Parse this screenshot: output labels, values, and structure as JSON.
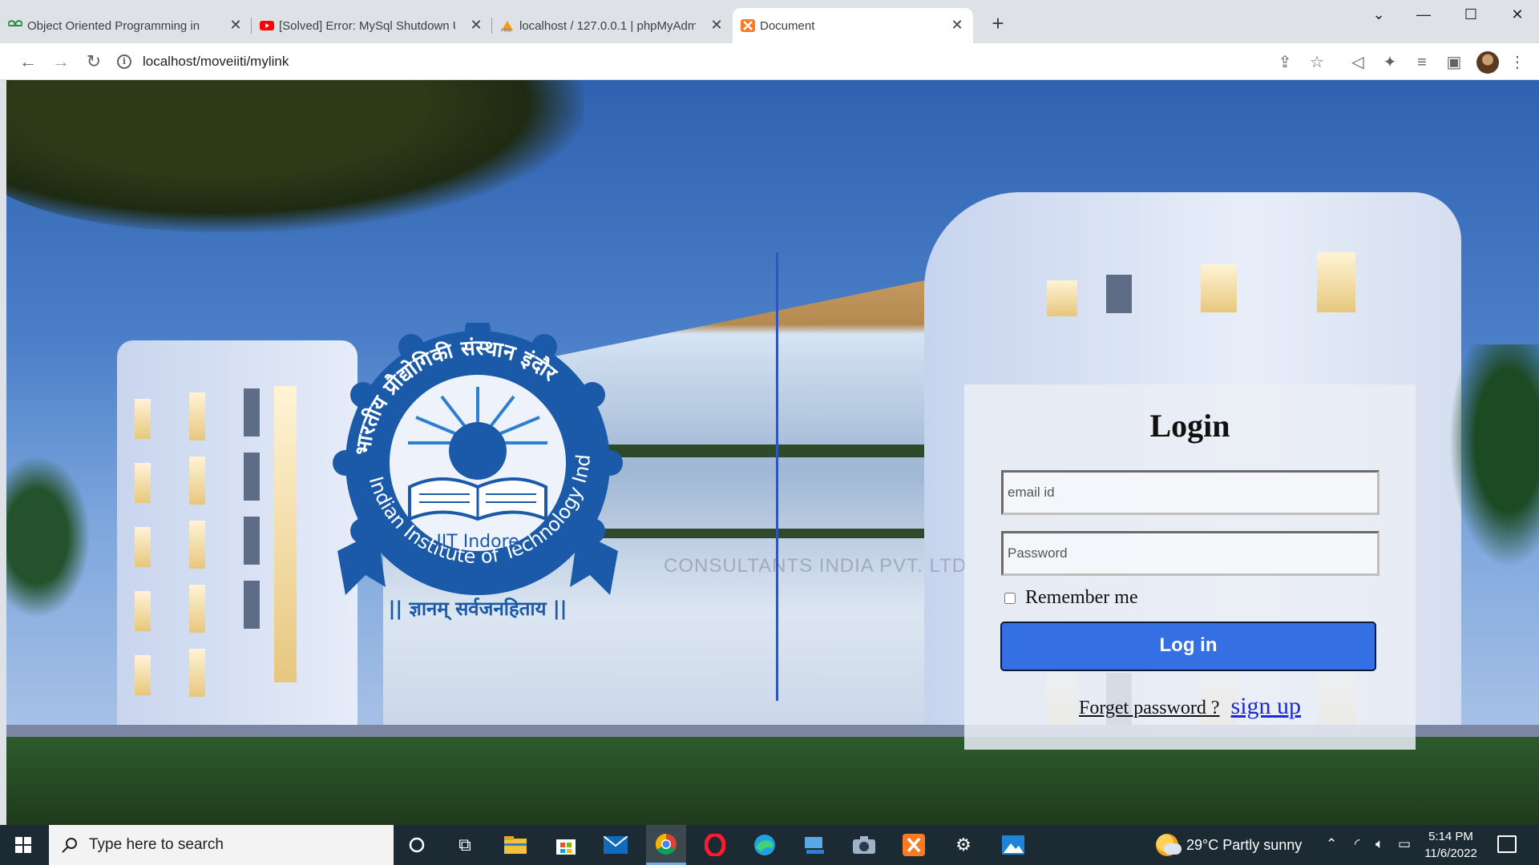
{
  "browser": {
    "tabs": [
      {
        "title": "Object Oriented Programming in",
        "favicon": "gfg-icon"
      },
      {
        "title": "[Solved] Error: MySql Shutdown U",
        "favicon": "youtube-icon"
      },
      {
        "title": "localhost / 127.0.0.1 | phpMyAdm",
        "favicon": "phpmyadmin-icon"
      },
      {
        "title": "Document",
        "favicon": "xampp-icon"
      }
    ],
    "url": "localhost/moveiiti/mylink"
  },
  "logo": {
    "hindi_top": "भारतीय प्रौद्योगिकी संस्थान इंदौर",
    "english_ring": "Indian Institute of Technology Indore",
    "center": "IIT Indore",
    "motto": "|| ज्ञानम् सर्वजनहिताय ||"
  },
  "watermark": "CONSULTANTS INDIA PVT. LTD",
  "login": {
    "title": "Login",
    "email_placeholder": "email id",
    "password_placeholder": "Password",
    "remember_label": "Remember me",
    "login_button": "Log in",
    "forget_link": "Forget password ?",
    "signup_link": "sign up"
  },
  "taskbar": {
    "search_placeholder": "Type here to search",
    "weather": "29°C  Partly sunny",
    "time": "5:14 PM",
    "date": "11/6/2022"
  },
  "colors": {
    "login_button": "#3470e4",
    "signup_link": "#1a2bd6",
    "logo_blue": "#1a5aa8",
    "taskbar": "#1c2a33"
  }
}
